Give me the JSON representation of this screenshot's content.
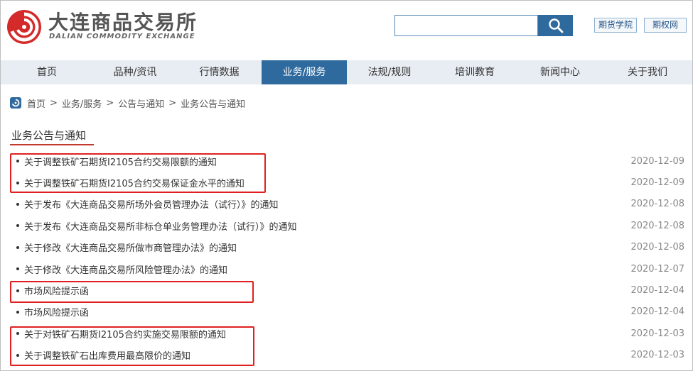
{
  "header": {
    "logo_cn": "大连商品交易所",
    "logo_en": "DALIAN COMMODITY EXCHANGE",
    "search": {
      "value": "",
      "placeholder": ""
    },
    "links": [
      "期货学院",
      "期权网"
    ]
  },
  "nav": {
    "items": [
      "首页",
      "品种/资讯",
      "行情数据",
      "业务/服务",
      "法规/规则",
      "培训教育",
      "新闻中心",
      "关于我们"
    ],
    "active": "业务/服务"
  },
  "breadcrumb": [
    "首页",
    "业务/服务",
    "公告与通知",
    "业务公告与通知"
  ],
  "breadcrumb_sep": ">",
  "section_title": "业务公告与通知",
  "notices": [
    {
      "title": "关于调整铁矿石期货I2105合约交易限额的通知",
      "date": "2020-12-09"
    },
    {
      "title": "关于调整铁矿石期货I2105合约交易保证金水平的通知",
      "date": "2020-12-09"
    },
    {
      "title": "关于发布《大连商品交易所场外会员管理办法（试行）》的通知",
      "date": "2020-12-08"
    },
    {
      "title": "关于发布《大连商品交易所非标仓单业务管理办法（试行）》的通知",
      "date": "2020-12-08"
    },
    {
      "title": "关于修改《大连商品交易所做市商管理办法》的通知",
      "date": "2020-12-08"
    },
    {
      "title": "关于修改《大连商品交易所风险管理办法》的通知",
      "date": "2020-12-07"
    },
    {
      "title": "市场风险提示函",
      "date": "2020-12-04"
    },
    {
      "title": "市场风险提示函",
      "date": "2020-12-04"
    },
    {
      "title": "关于对铁矿石期货I2105合约实施交易限额的通知",
      "date": "2020-12-03"
    },
    {
      "title": "关于调整铁矿石出库费用最高限价的通知",
      "date": "2020-12-03"
    }
  ],
  "colors": {
    "primary": "#2f6a9e",
    "nav_bg": "#e8edf3",
    "highlight": "#e02020",
    "title_underline": "#c0392b"
  }
}
